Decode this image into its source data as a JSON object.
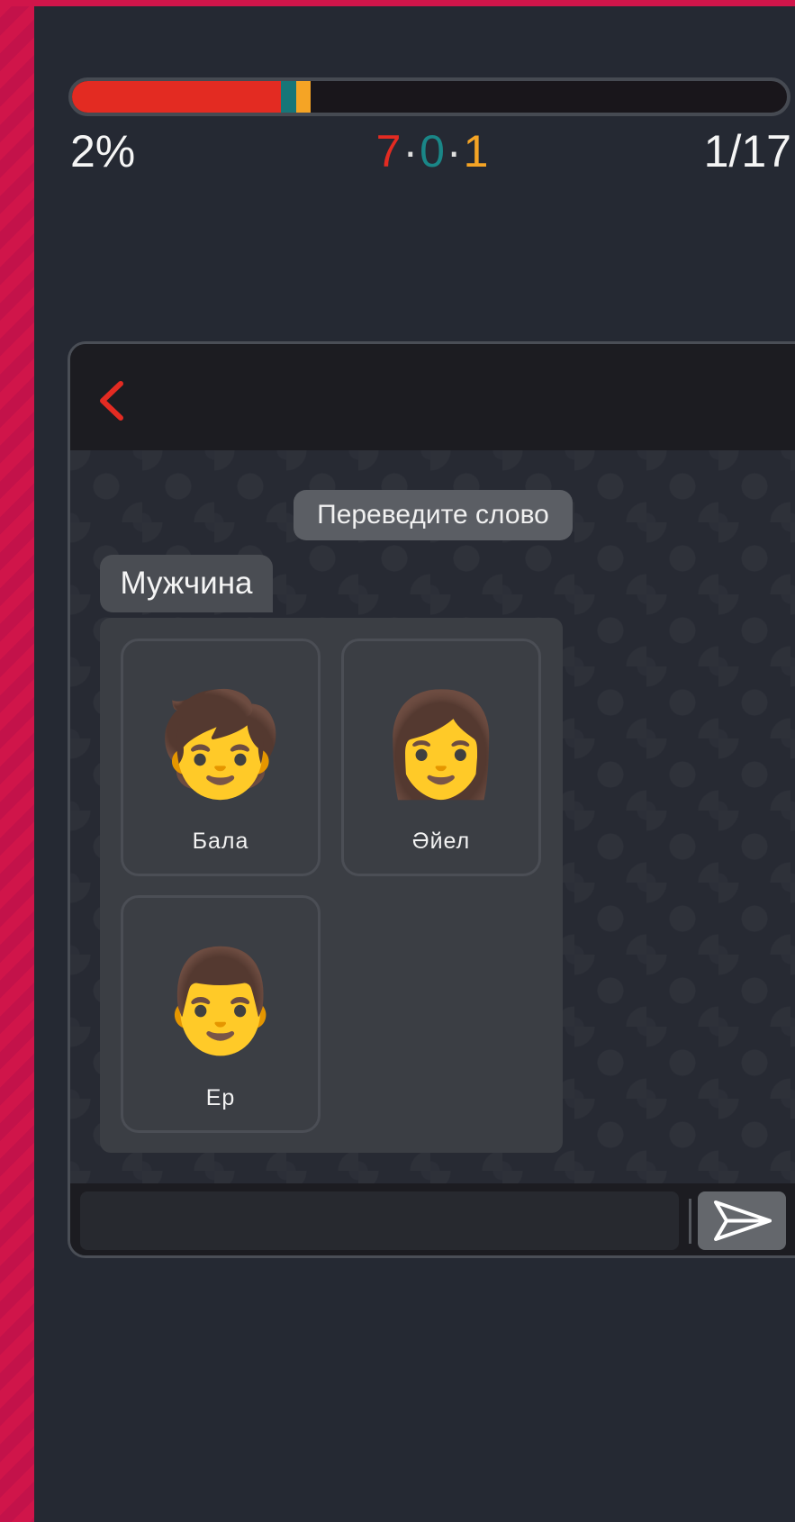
{
  "progress": {
    "percent_label": "2%",
    "counter_label": "1/17",
    "segments": [
      {
        "name": "wrong",
        "fraction": 0.292,
        "color": "#e32b22"
      },
      {
        "name": "neutral",
        "fraction": 0.021,
        "color": "#177678"
      },
      {
        "name": "correct",
        "fraction": 0.021,
        "color": "#f5a425"
      }
    ],
    "score": {
      "wrong": "7",
      "neutral": "0",
      "correct": "1",
      "separator": "·",
      "colors": {
        "wrong": "#e32b22",
        "neutral": "#1a8687",
        "correct": "#f5a425"
      }
    }
  },
  "chat": {
    "back_icon": "chevron-left-icon",
    "system_message": "Переведите слово",
    "prompt_word": "Мужчина",
    "options": [
      {
        "emoji": "🧒",
        "label": "Бала"
      },
      {
        "emoji": "👩",
        "label": "Әйел"
      },
      {
        "emoji": "👨",
        "label": "Ер"
      }
    ],
    "input": {
      "value": "",
      "placeholder": ""
    },
    "send_icon": "send-icon"
  },
  "colors": {
    "accent": "#e32b22",
    "brand_stripe": "#d0154a",
    "background": "#252933"
  }
}
